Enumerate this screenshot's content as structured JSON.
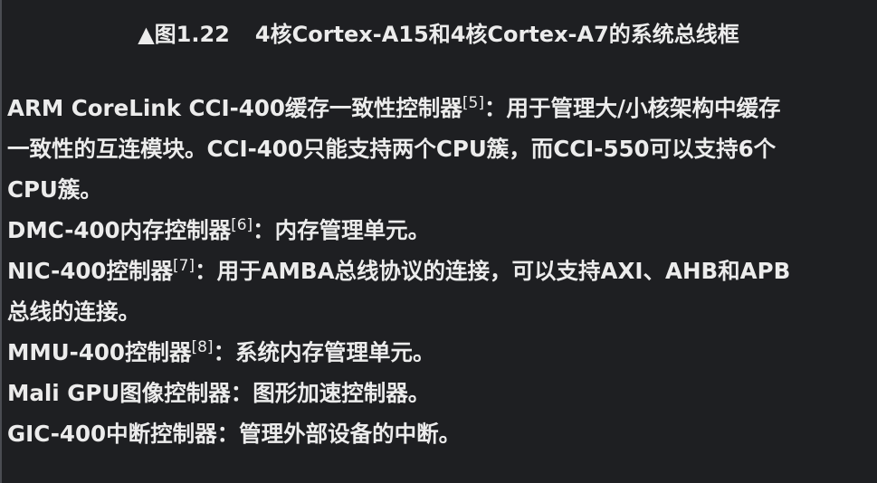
{
  "caption": {
    "triangle": "▲",
    "figure_no": "图1.22",
    "title": "4核Cortex-A15和4核Cortex-A7的系统总线框"
  },
  "items": [
    {
      "name": "ARM CoreLink CCI-400缓存一致性控制器",
      "ref": "[5]",
      "lines": [
        "：用于管理大/小核架构中缓存",
        "一致性的互连模块。CCI-400只能支持两个CPU簇，而CCI-550可以支持6个",
        "CPU簇。"
      ]
    },
    {
      "name": "DMC-400内存控制器",
      "ref": "[6]",
      "lines": [
        "：内存管理单元。"
      ]
    },
    {
      "name": "NIC-400控制器",
      "ref": "[7]",
      "lines": [
        "：用于AMBA总线协议的连接，可以支持AXI、AHB和APB",
        "总线的连接。"
      ]
    },
    {
      "name": "MMU-400控制器",
      "ref": "[8]",
      "lines": [
        "：系统内存管理单元。"
      ]
    },
    {
      "name": "Mali GPU图像控制器",
      "ref": "",
      "lines": [
        "：图形加速控制器。"
      ]
    },
    {
      "name": "GIC-400中断控制器",
      "ref": "",
      "lines": [
        "：管理外部设备的中断。"
      ]
    }
  ]
}
